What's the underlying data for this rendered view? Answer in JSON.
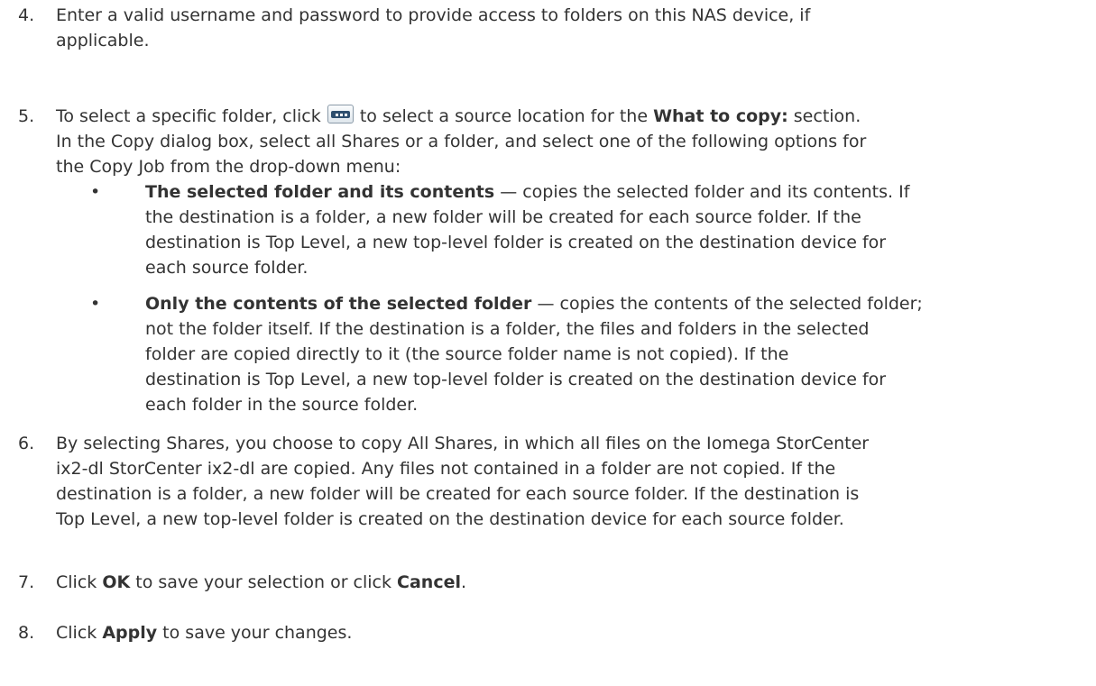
{
  "steps": [
    {
      "number": "4.",
      "line1": "Enter a valid username and password to provide access to folders on this NAS device, if",
      "line2": "applicable."
    },
    {
      "number": "5.",
      "line1_pre": "To select a specific folder, click",
      "line1_mid": "to select a source location for the",
      "line1_bold": "What to copy:",
      "line1_post": "section.",
      "line2": "In the Copy dialog box, select all Shares or a folder, and select one of the following options for",
      "line3": "the Copy Job from the drop-down menu:",
      "icon": "ellipsis-browse-button-icon",
      "bullets": [
        {
          "bold": "The selected folder and its contents",
          "line1_rest": " — copies the selected folder and its contents. If",
          "line2": "the destination is a folder, a new folder will be created for each source folder. If the",
          "line3": "destination is Top Level, a new top-level folder is created on the destination device for",
          "line4": "each source folder."
        },
        {
          "bold": "Only the contents of the selected folder",
          "line1_rest": " — copies the contents of the selected folder;",
          "line2": "not the folder itself. If the destination is a folder, the files and folders in the selected",
          "line3": "folder are copied directly to it (the source folder name is not copied). If the",
          "line4": "destination is Top Level, a new top-level folder is created on the destination device for",
          "line5": "each folder in the source folder."
        }
      ]
    },
    {
      "number": "6.",
      "line1": "By selecting Shares, you choose to copy All Shares, in which all files on the Iomega StorCenter",
      "line2": "ix2-dl StorCenter ix2-dl are copied. Any files not contained in a folder are not copied. If the",
      "line3": "destination is a folder, a new folder will be created for each source folder. If the destination is",
      "line4": "Top Level, a new top-level folder is created on the destination device for each source folder."
    },
    {
      "number": "7.",
      "pre": "Click ",
      "bold1": "OK",
      "mid": " to save your selection or click ",
      "bold2": "Cancel",
      "post": "."
    },
    {
      "number": "8.",
      "pre": "Click ",
      "bold1": "Apply",
      "post": " to save your changes."
    }
  ],
  "bullet_char": "•"
}
